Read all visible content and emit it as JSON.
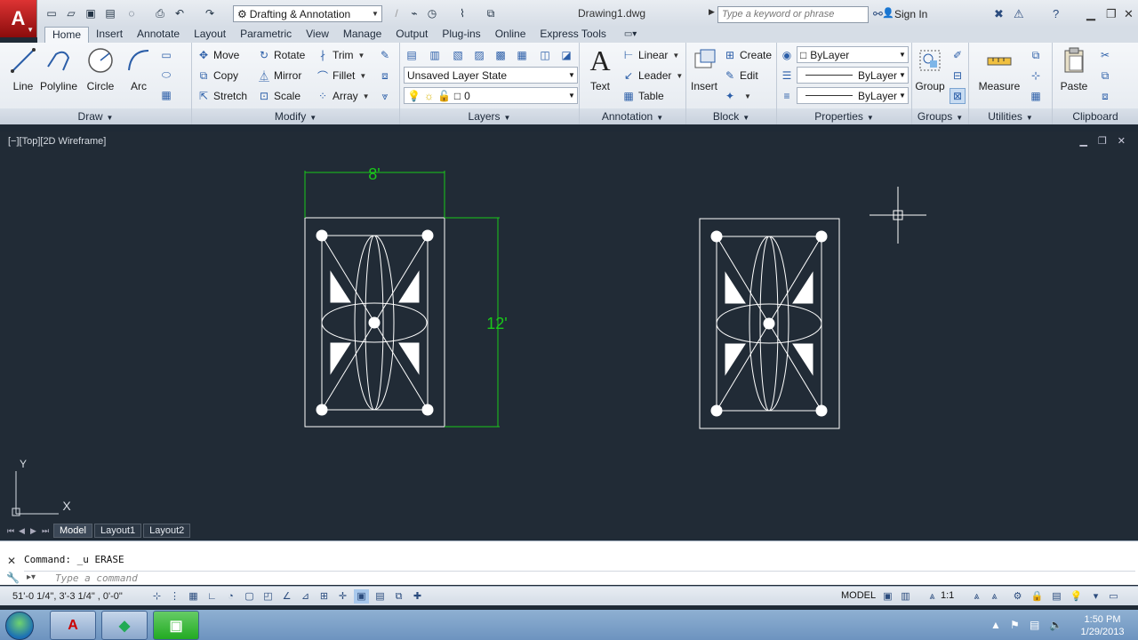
{
  "title_bar": {
    "workspace": "Drafting & Annotation",
    "document": "Drawing1.dwg",
    "search_placeholder": "Type a keyword or phrase",
    "sign_in": "Sign In"
  },
  "ribbon_tabs": [
    "Home",
    "Insert",
    "Annotate",
    "Layout",
    "Parametric",
    "View",
    "Manage",
    "Output",
    "Plug-ins",
    "Online",
    "Express Tools"
  ],
  "draw": {
    "title": "Draw",
    "line": "Line",
    "polyline": "Polyline",
    "circle": "Circle",
    "arc": "Arc"
  },
  "modify": {
    "title": "Modify",
    "move": "Move",
    "rotate": "Rotate",
    "trim": "Trim",
    "copy": "Copy",
    "mirror": "Mirror",
    "fillet": "Fillet",
    "stretch": "Stretch",
    "scale": "Scale",
    "array": "Array"
  },
  "layers": {
    "title": "Layers",
    "state": "Unsaved Layer State",
    "current": "0"
  },
  "annotation": {
    "title": "Annotation",
    "text": "Text",
    "linear": "Linear",
    "leader": "Leader",
    "table": "Table"
  },
  "block": {
    "title": "Block",
    "insert": "Insert",
    "create": "Create",
    "edit": "Edit"
  },
  "properties": {
    "title": "Properties",
    "color": "ByLayer",
    "lineweight": "ByLayer",
    "linetype": "ByLayer"
  },
  "groups": {
    "title": "Groups",
    "group": "Group"
  },
  "utilities": {
    "title": "Utilities",
    "measure": "Measure"
  },
  "clipboard": {
    "title": "Clipboard",
    "paste": "Paste"
  },
  "viewport": {
    "label": "[−][Top][2D Wireframe]",
    "dim_width": "8'",
    "dim_height": "12'",
    "ucs_y": "Y",
    "ucs_x": "X"
  },
  "layout_tabs": [
    "Model",
    "Layout1",
    "Layout2"
  ],
  "command": {
    "history": "Command: _u ERASE",
    "placeholder": "Type a command"
  },
  "status": {
    "coords": "51'-0 1/4\",  3'-3 1/4\" , 0'-0\"",
    "model": "MODEL",
    "scale": "1:1"
  },
  "taskbar": {
    "time": "1:50 PM",
    "date": "1/29/2013"
  },
  "colors": {
    "background": "#212b36",
    "geometry": "#ffffff",
    "dimension": "#19c819",
    "ribbon": "#e4e9ef"
  },
  "icons": [
    "application-menu-icon",
    "new-icon",
    "open-icon",
    "save-icon",
    "plot-icon",
    "undo-icon",
    "redo-icon",
    "binoculars-icon",
    "user-icon",
    "exchange-icon",
    "help-icon"
  ]
}
